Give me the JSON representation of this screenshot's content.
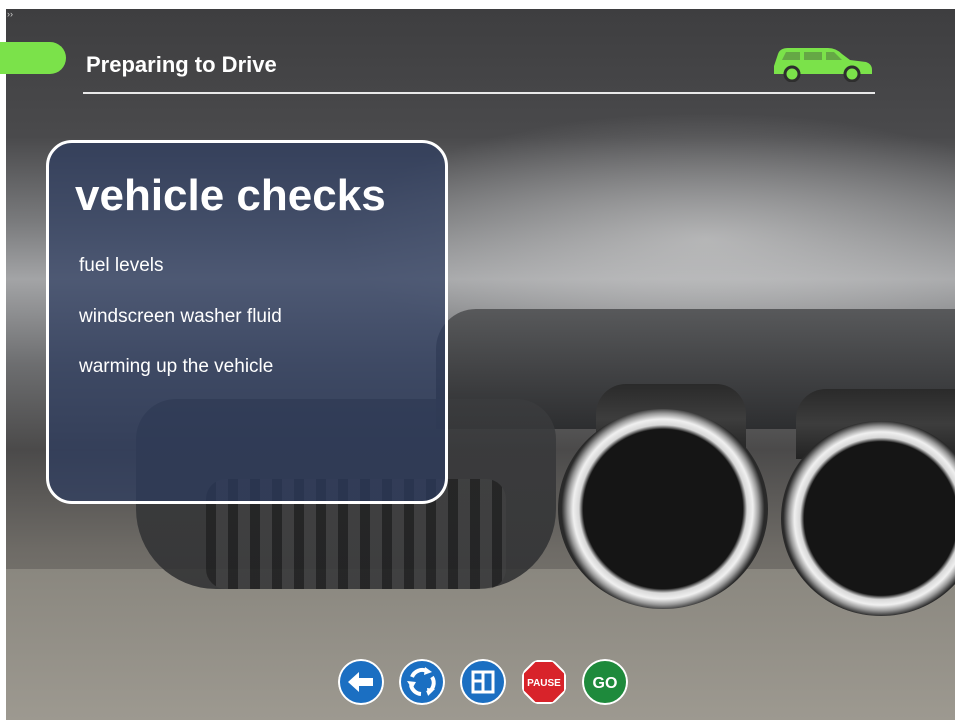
{
  "header": {
    "title": "Preparing to Drive",
    "accent_color": "#7be24a",
    "icon": "car-icon"
  },
  "panel": {
    "title": "vehicle checks",
    "items": [
      "fuel levels",
      "windscreen washer fluid",
      "warming up the vehicle"
    ]
  },
  "nav": {
    "back_icon": "back-arrow-icon",
    "replay_icon": "replay-icon",
    "menu_icon": "menu-icon",
    "pause_label": "PAUSE",
    "go_label": "GO",
    "blue": "#1b6fc2",
    "red": "#d8232a",
    "green": "#1e8a3c"
  },
  "corner_glyph": "››"
}
